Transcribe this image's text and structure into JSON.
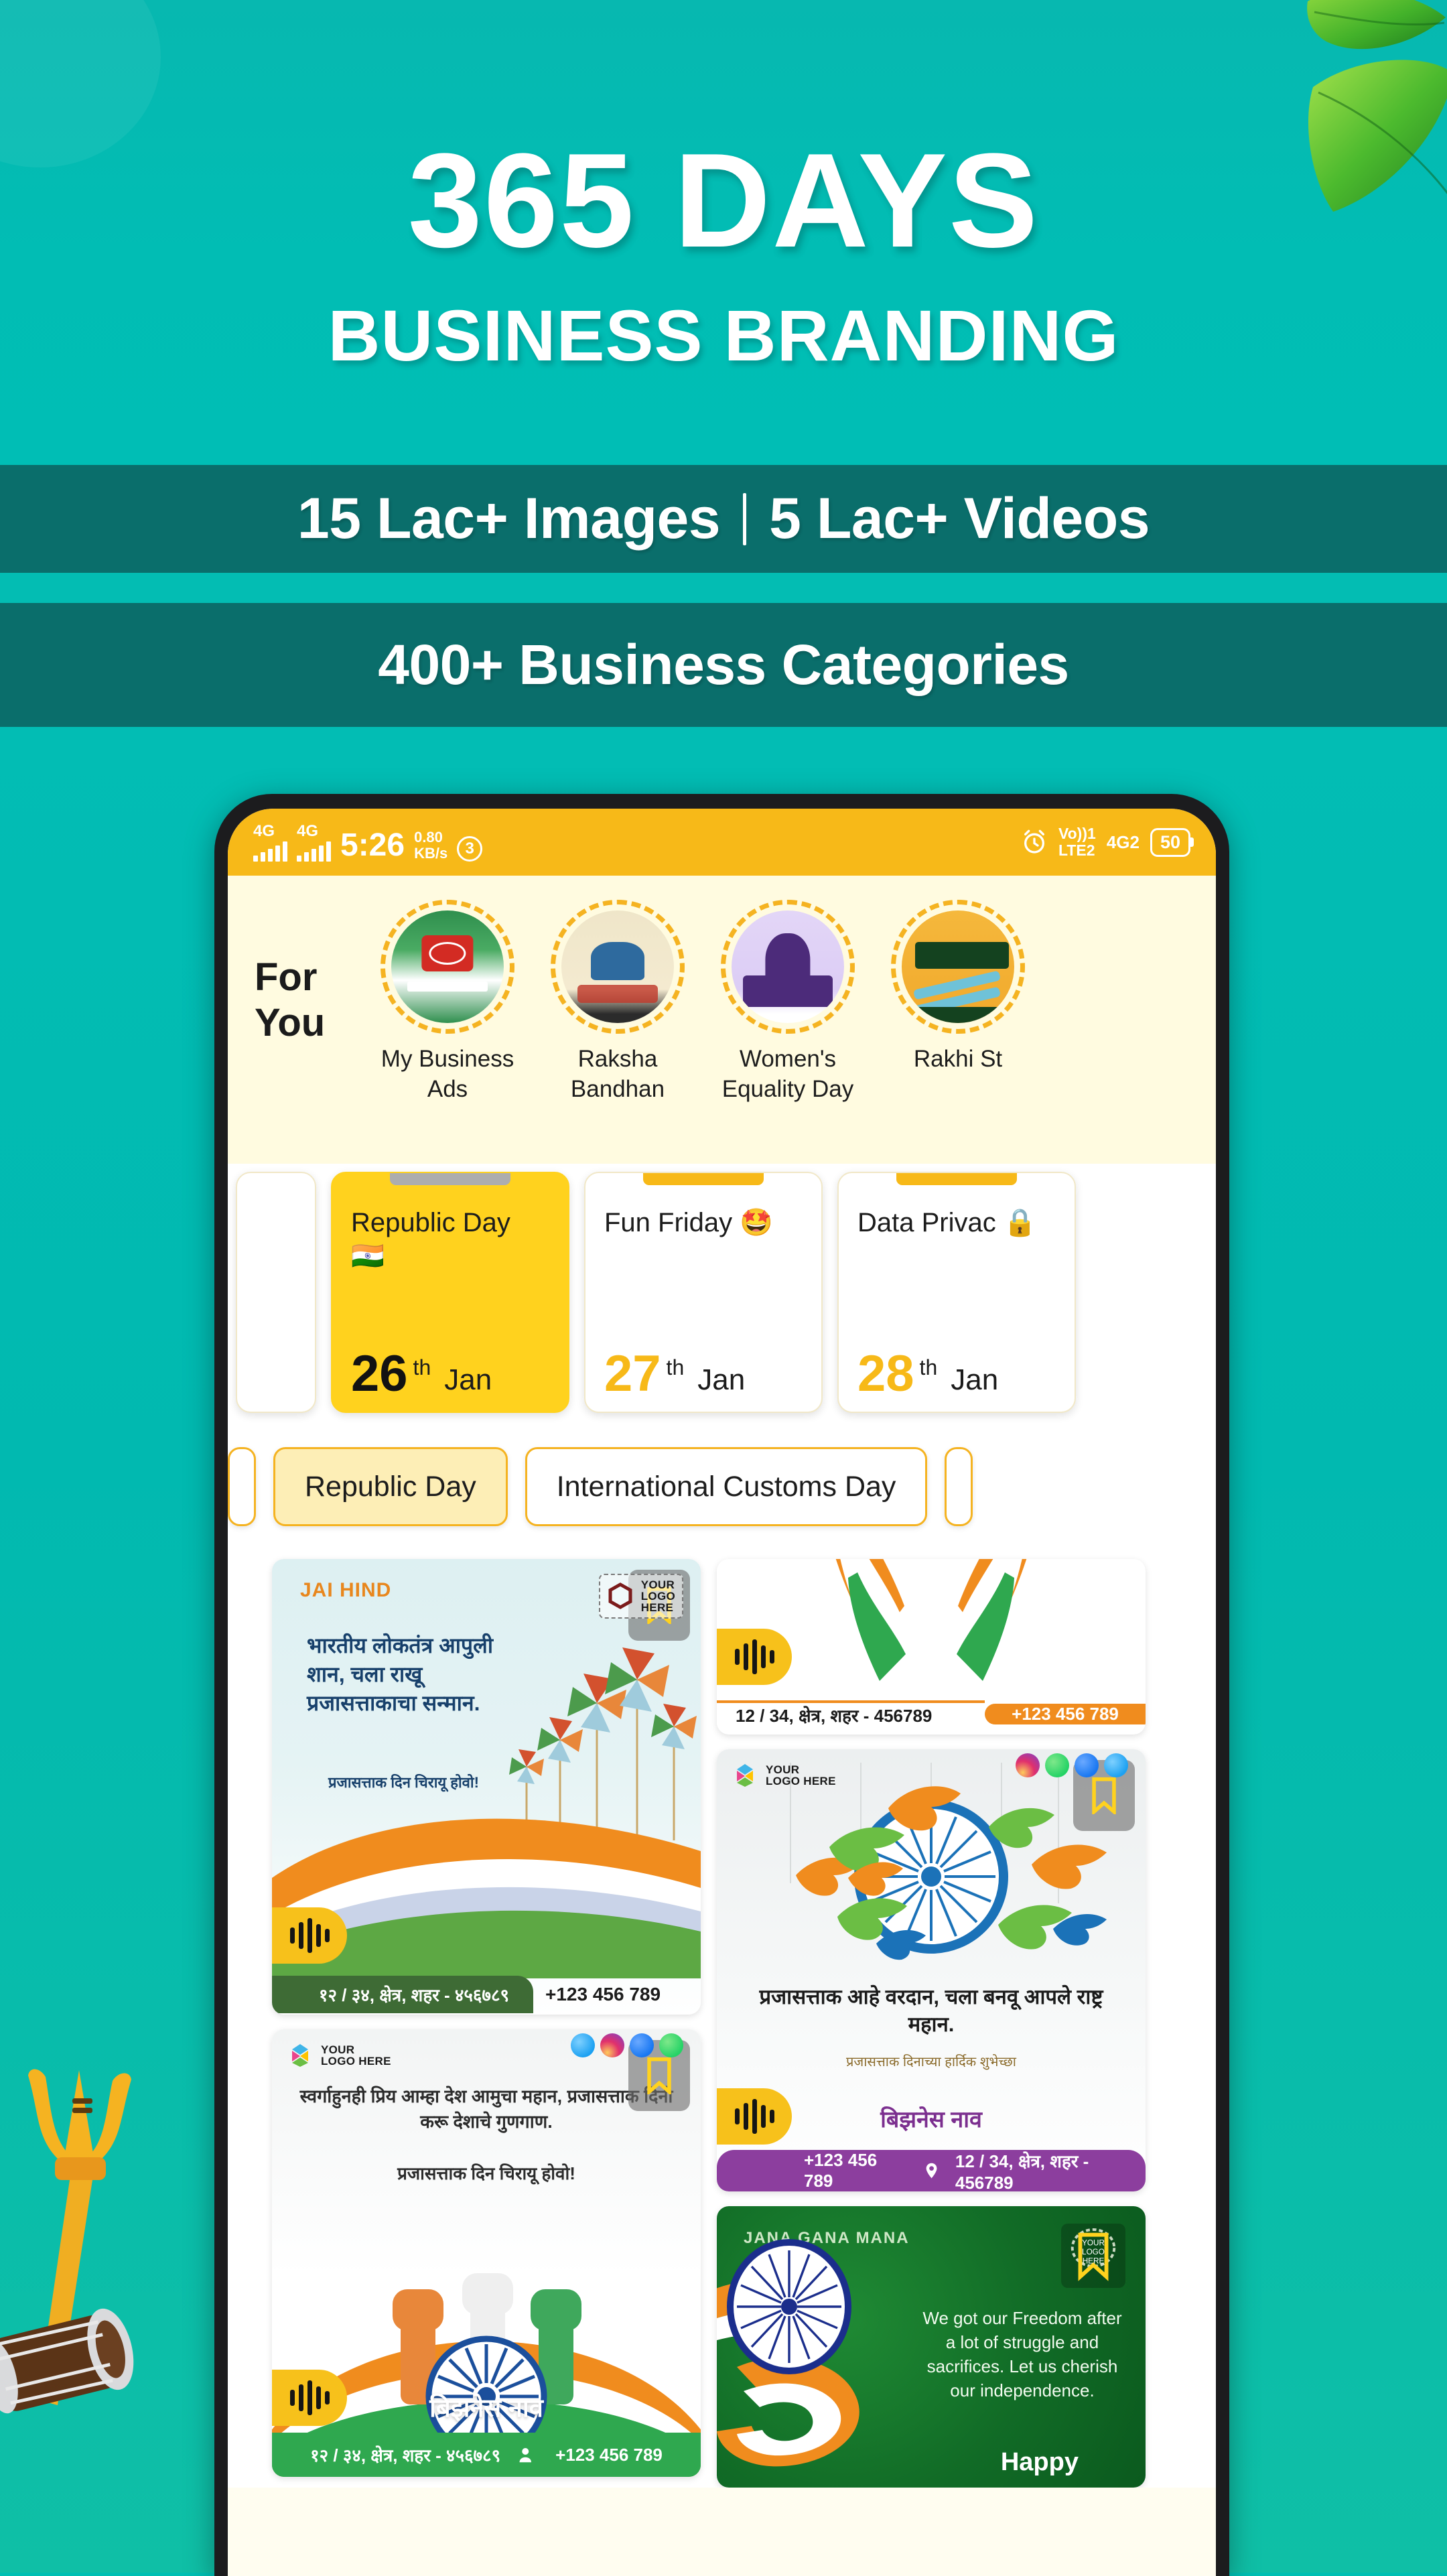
{
  "hero": {
    "line1": "365 DAYS",
    "line2": "BUSINESS BRANDING"
  },
  "bands": {
    "band1_left": "15 Lac+ Images",
    "band1_right": "5 Lac+ Videos",
    "band2": "400+ Business Categories"
  },
  "colors": {
    "teal_light": "#00BFB3",
    "teal_dark": "#0A6E6B",
    "accent_yellow": "#F7B918",
    "active_yellow": "#FFD21E",
    "cream": "#FFFBE0"
  },
  "phone": {
    "statusbar": {
      "network_1": "4G",
      "network_2": "4G",
      "time": "5:26",
      "speed_value": "0.80",
      "speed_unit": "KB/s",
      "notification_count": "3",
      "alarm_icon": "alarm-icon",
      "volte_line1": "Vo))1",
      "volte_line2": "LTE2",
      "sim2_network": "4G2",
      "battery": "50"
    },
    "foryou": {
      "label_line1": "For",
      "label_line2": "You",
      "categories": [
        {
          "label": "My Business Ads",
          "art": "art-biz"
        },
        {
          "label": "Raksha Bandhan",
          "art": "art-raksha"
        },
        {
          "label": "Women's Equality Day",
          "art": "art-women"
        },
        {
          "label": "Rakhi St",
          "art": "art-rakhi"
        }
      ]
    },
    "dates": [
      {
        "title": "Republic Day 🇮🇳",
        "day": "26",
        "suffix": "th",
        "month": "Jan",
        "active": true
      },
      {
        "title": "Fun Friday 🤩",
        "day": "27",
        "suffix": "th",
        "month": "Jan",
        "active": false
      },
      {
        "title": "Data Privac 🔒",
        "day": "28",
        "suffix": "th",
        "month": "Jan",
        "active": false
      }
    ],
    "chips": [
      {
        "label": "Republic Day",
        "active": true
      },
      {
        "label": "International Customs Day",
        "active": false
      }
    ],
    "gallery": {
      "card_jaihind": {
        "badge": "JAI HIND",
        "poem": "भारतीय लोकतंत्र आपुली शान, चला राखू प्रजासत्ताकाचा सन्मान.",
        "poem_sub": "प्रजासत्ताक दिन चिरायू होवो!",
        "logo_text_line1": "YOUR",
        "logo_text_line2": "LOGO",
        "logo_text_line3": "HERE",
        "address": "१२ / ३४, क्षेत्र, शहर - ४५६७८९",
        "phone": "+123 456 789"
      },
      "card_tricolorhands": {
        "address": "12 / 34, क्षेत्र, शहर - 456789",
        "phone": "+123 456 789"
      },
      "card_doves": {
        "logo_text_line1": "YOUR",
        "logo_text_line2": "LOGO HERE",
        "quote": "प्रजासत्ताक आहे वरदान, चला बनवू आपले राष्ट्र महान.",
        "quote_sub": "प्रजासत्ताक दिनाच्या हार्दिक शुभेच्छा",
        "business_name": "बिझनेस नाव",
        "phone": "+123 456 789",
        "address": "12 / 34, क्षेत्र, शहर - 456789"
      },
      "card_fists": {
        "logo_text_line1": "YOUR",
        "logo_text_line2": "LOGO HERE",
        "poem": "स्वर्गाहुनही प्रिय आम्हा देश आमुचा महान, प्रजासत्ताक दिनी करू देशाचे गुणगाण.",
        "poem_sub": "प्रजासत्ताक दिन चिरायू होवो!",
        "business_name": "बिझनेस नाव",
        "address": "१२ / ३४, क्षेत्र, शहर - ४५६७८९",
        "phone": "+123 456 789"
      },
      "card_freedom": {
        "anthem": "JANA GANA MANA",
        "text": "We got our Freedom after a lot of struggle and sacrifices. Let us cherish our independence.",
        "happy": "Happy",
        "logo_badge_line1": "YOUR",
        "logo_badge_line2": "LOGO",
        "logo_badge_line3": "HERE"
      }
    }
  }
}
